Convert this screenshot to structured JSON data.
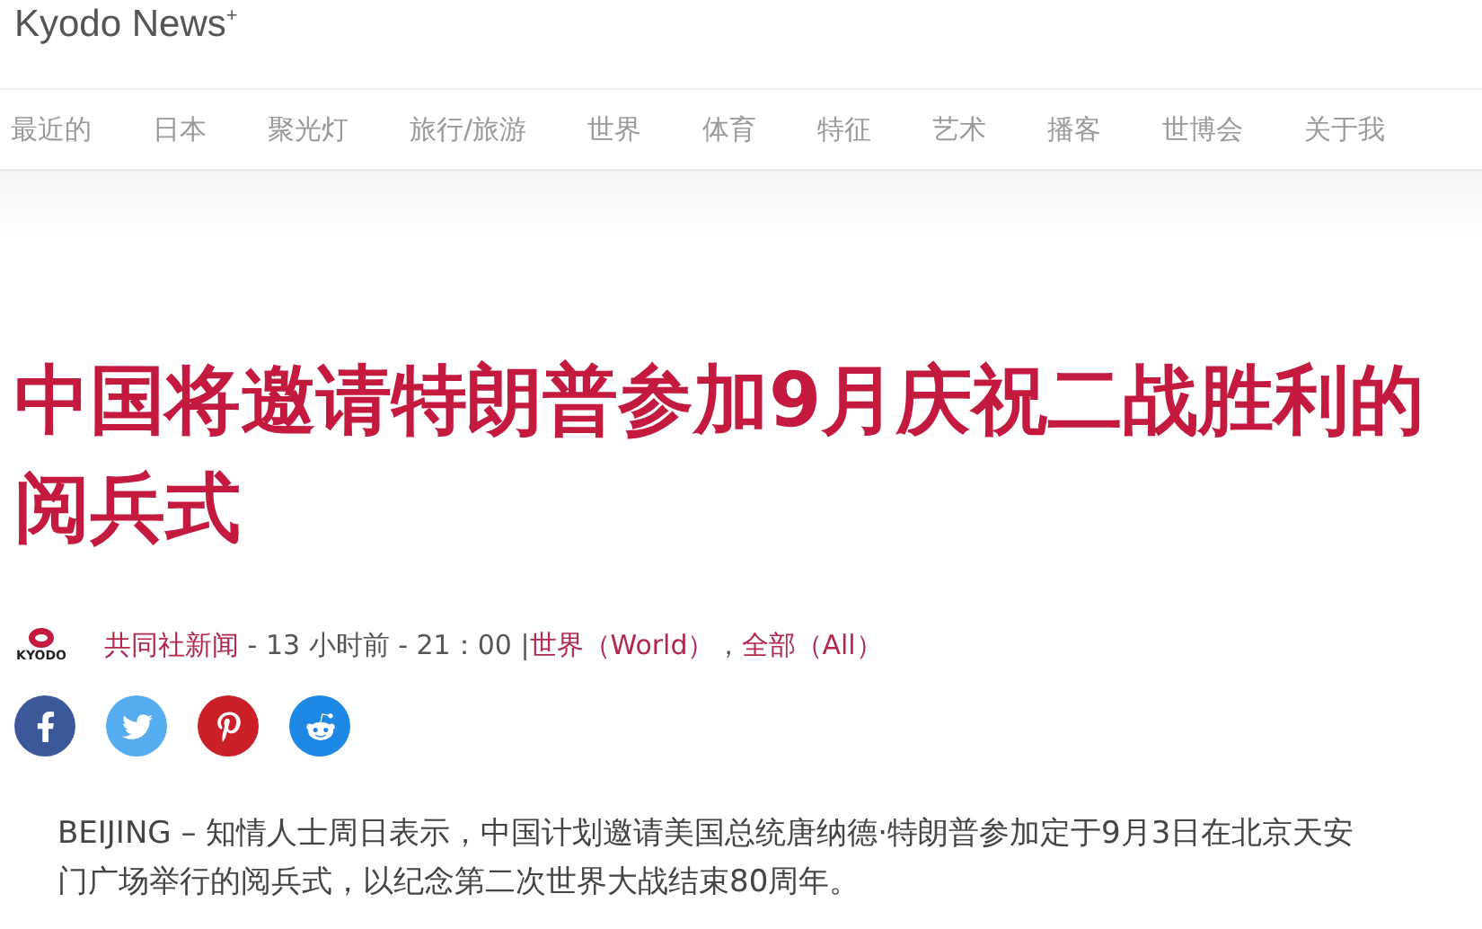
{
  "site": {
    "name": "Kyodo News",
    "mark": "+"
  },
  "nav": [
    {
      "label": "最近的"
    },
    {
      "label": "日本"
    },
    {
      "label": "聚光灯"
    },
    {
      "label": "旅行/旅游"
    },
    {
      "label": "世界"
    },
    {
      "label": "体育"
    },
    {
      "label": "特征"
    },
    {
      "label": "艺术"
    },
    {
      "label": "播客"
    },
    {
      "label": "世博会"
    },
    {
      "label": "关于我"
    }
  ],
  "article": {
    "title": "中国将邀请特朗普参加9月庆祝二战胜利的阅兵式",
    "source_logo": "KYODO",
    "source": "共同社新闻",
    "meta": " - 13 小时前 - 21：00 |",
    "category": "世界（World）",
    "separator": "，",
    "tag": "全部（All）",
    "share": [
      {
        "kind": "facebook"
      },
      {
        "kind": "twitter"
      },
      {
        "kind": "pinterest"
      },
      {
        "kind": "reddit"
      }
    ],
    "body": "BEIJING – 知情人士周日表示，中国计划邀请美国总统唐纳德·特朗普参加定于9月3日在北京天安门广场举行的阅兵式，以纪念第二次世界大战结束80周年。"
  }
}
